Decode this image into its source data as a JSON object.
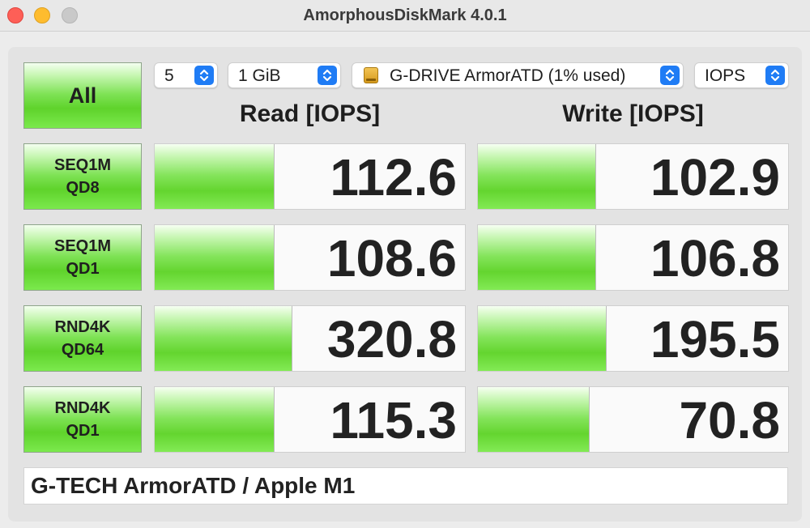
{
  "window": {
    "title": "AmorphousDiskMark 4.0.1"
  },
  "controls": {
    "all_label": "All",
    "count_value": "5",
    "size_value": "1 GiB",
    "drive_value": "G-DRIVE ArmorATD (1% used)",
    "unit_value": "IOPS"
  },
  "headers": {
    "read": "Read [IOPS]",
    "write": "Write [IOPS]"
  },
  "tests": [
    {
      "line1": "SEQ1M",
      "line2": "QD8",
      "read": "112.6",
      "write": "102.9",
      "read_fill": 0.385,
      "write_fill": 0.378
    },
    {
      "line1": "SEQ1M",
      "line2": "QD1",
      "read": "108.6",
      "write": "106.8",
      "read_fill": 0.385,
      "write_fill": 0.378
    },
    {
      "line1": "RND4K",
      "line2": "QD64",
      "read": "320.8",
      "write": "195.5",
      "read_fill": 0.44,
      "write_fill": 0.412
    },
    {
      "line1": "RND4K",
      "line2": "QD1",
      "read": "115.3",
      "write": "70.8",
      "read_fill": 0.385,
      "write_fill": 0.358
    }
  ],
  "footer": {
    "text": "G-TECH ArmorATD / Apple M1"
  },
  "colors": {
    "accent": "#1f7cf5",
    "bar_green": "#64d52f"
  }
}
